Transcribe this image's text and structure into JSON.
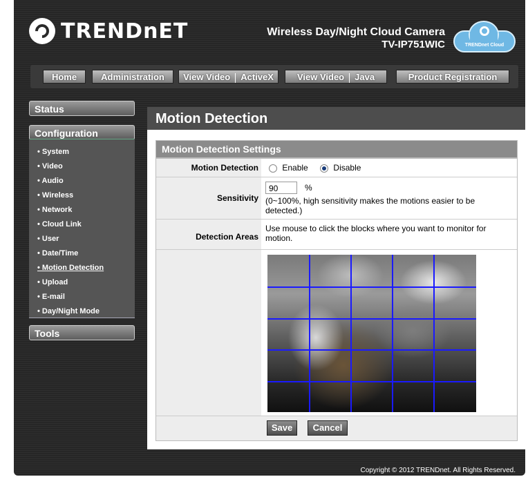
{
  "brand": {
    "logo_text": "TRENDnET",
    "product_line": "Wireless Day/Night Cloud Camera",
    "model": "TV-IP751WIC",
    "cloud_badge": "TRENDnet Cloud"
  },
  "nav": {
    "home": "Home",
    "administration": "Administration",
    "view_video": "View Video",
    "activex": "ActiveX",
    "java": "Java",
    "product_registration": "Product Registration"
  },
  "sidebar": {
    "status": "Status",
    "configuration": "Configuration",
    "tools": "Tools",
    "items": [
      "• System",
      "• Video",
      "• Audio",
      "• Wireless",
      "• Network",
      "• Cloud Link",
      "• User",
      "• Date/Time",
      "• Motion Detection",
      "• Upload",
      "• E-mail",
      "• Day/Night Mode"
    ],
    "active_item": "• Motion Detection"
  },
  "page": {
    "title": "Motion Detection",
    "section": "Motion Detection Settings",
    "motion_label": "Motion Detection",
    "enable_label": "Enable",
    "disable_label": "Disable",
    "motion_value": "Disable",
    "sensitivity_label": "Sensitivity",
    "sensitivity_value": "90",
    "sensitivity_unit": "%",
    "sensitivity_hint": "(0~100%, high sensitivity makes the motions easier to be detected.)",
    "areas_label": "Detection Areas",
    "areas_hint": "Use mouse to click the blocks where you want to monitor for motion.",
    "save": "Save",
    "cancel": "Cancel"
  },
  "footer": "Copyright © 2012 TRENDnet.  All Rights Reserved.",
  "colors": {
    "grid_line": "#1a1aff",
    "frame": "#2a2a2a",
    "section_head": "#8b8b8b"
  }
}
